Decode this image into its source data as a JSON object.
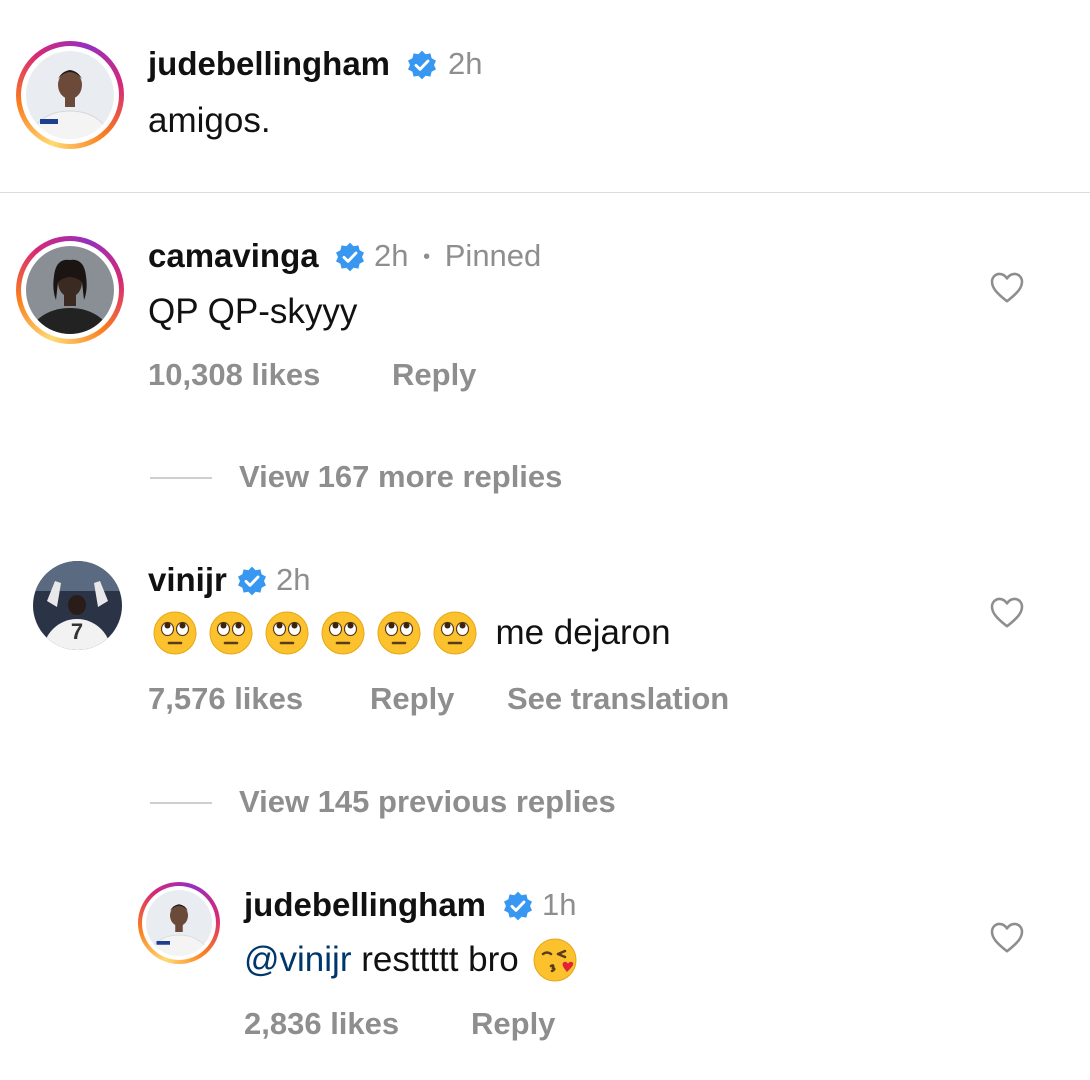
{
  "caption": {
    "username": "judebellingham",
    "time": "2h",
    "text": "amigos."
  },
  "comments": [
    {
      "username": "camavinga",
      "time": "2h",
      "separator": "•",
      "pinned_label": "Pinned",
      "text": "QP QP-skyyy",
      "likes": "10,308 likes",
      "reply_label": "Reply",
      "view_replies": "View 167 more replies"
    },
    {
      "username": "vinijr",
      "time": "2h",
      "emoji_icon": "face-with-rolling-eyes-emoji",
      "emoji_count": 6,
      "text": "me dejaron",
      "likes": "7,576 likes",
      "reply_label": "Reply",
      "translate_label": "See translation",
      "view_replies": "View 145 previous replies"
    }
  ],
  "reply": {
    "username": "judebellingham",
    "time": "1h",
    "mention": "@vinijr",
    "text": " resttttt bro",
    "emoji_icon": "face-blowing-kiss-emoji",
    "likes": "2,836 likes",
    "reply_label": "Reply"
  },
  "colors": {
    "verified_badge": "#3897f0",
    "secondary_text": "#8e8e8e",
    "mention": "#00376b"
  }
}
